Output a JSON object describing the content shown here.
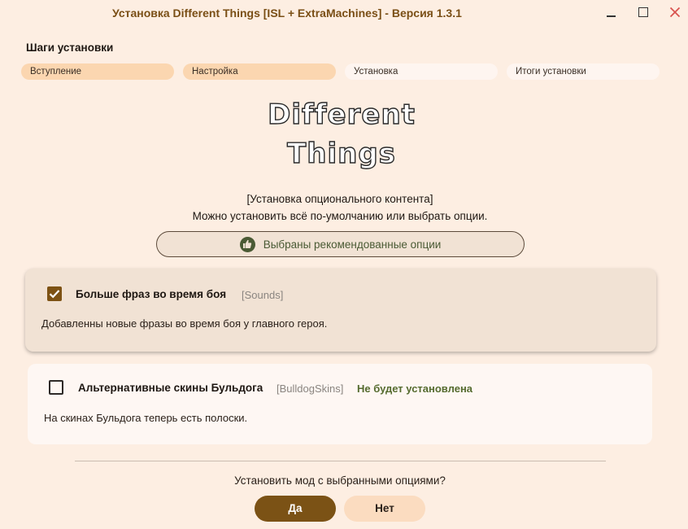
{
  "window": {
    "title": "Установка Different Things [ISL + ExtraMachines] - Версия 1.3.1",
    "controls": [
      "minimize-icon",
      "maximize-icon",
      "close-icon"
    ],
    "accent_color": "#7a4f16",
    "close_color": "#d9534f"
  },
  "steps": {
    "title": "Шаги установки",
    "items": [
      {
        "label": "Вступление",
        "state": "done"
      },
      {
        "label": "Настройка",
        "state": "active"
      },
      {
        "label": "Установка",
        "state": "pending"
      },
      {
        "label": "Итоги установки",
        "state": "pending"
      }
    ]
  },
  "logo": {
    "line1": "Different",
    "line2": "Things"
  },
  "intro": {
    "line1": "[Установка опционального контента]",
    "line2": "Можно установить всё по-умолчанию или выбрать опции."
  },
  "recommended": {
    "icon": "thumbs-up-icon",
    "label": "Выбраны рекомендованные опции"
  },
  "options": [
    {
      "title": "Больше фраз во время боя",
      "tag": "[Sounds]",
      "status": "",
      "description": "Добавленны новые фразы во время боя у главного героя.",
      "checked": true
    },
    {
      "title": "Альтернативные скины Бульдога",
      "tag": "[BulldogSkins]",
      "status": "Не будет установлена",
      "description": "На скинах Бульдога теперь есть полоски.",
      "checked": false
    }
  ],
  "footer": {
    "question": "Установить мод с выбранными опциями?",
    "yes_label": "Да",
    "no_label": "Нет"
  }
}
